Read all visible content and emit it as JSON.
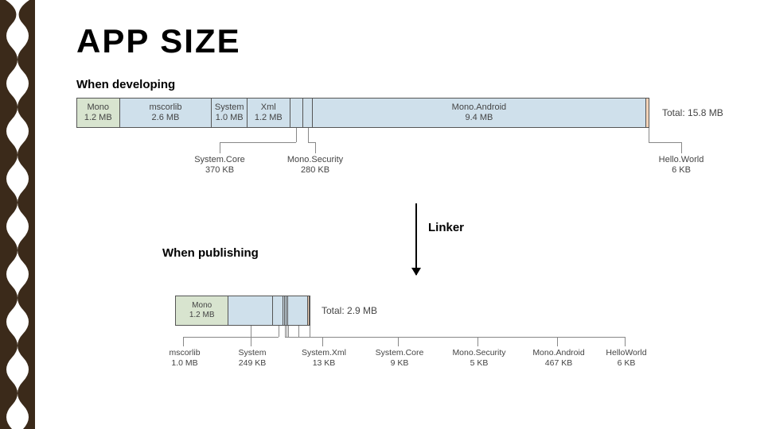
{
  "title": "APP SIZE",
  "labels": {
    "developing": "When developing",
    "publishing": "When publishing",
    "linker": "Linker"
  },
  "chart_data": [
    {
      "type": "bar",
      "title": "When developing",
      "total_label": "Total: 15.8 MB",
      "segments": [
        {
          "name": "Mono",
          "size_label": "1.2 MB",
          "kb": 1229,
          "color": "mono",
          "inline": true
        },
        {
          "name": "mscorlib",
          "size_label": "2.6 MB",
          "kb": 2662,
          "color": "lib",
          "inline": true
        },
        {
          "name": "System",
          "size_label": "1.0 MB",
          "kb": 1024,
          "color": "lib",
          "inline": true
        },
        {
          "name": "Xml",
          "size_label": "1.2 MB",
          "kb": 1229,
          "color": "lib",
          "inline": true
        },
        {
          "name": "System.Core",
          "size_label": "370 KB",
          "kb": 370,
          "color": "lib",
          "inline": false
        },
        {
          "name": "Mono.Security",
          "size_label": "280 KB",
          "kb": 280,
          "color": "lib",
          "inline": false
        },
        {
          "name": "Mono.Android",
          "size_label": "9.4 MB",
          "kb": 9626,
          "color": "lib",
          "inline": true
        },
        {
          "name": "Hello.World",
          "size_label": "6 KB",
          "kb": 6,
          "color": "orange",
          "inline": false
        }
      ]
    },
    {
      "type": "bar",
      "title": "When publishing",
      "total_label": "Total: 2.9 MB",
      "segments": [
        {
          "name": "Mono",
          "size_label": "1.2 MB",
          "kb": 1229,
          "color": "mono",
          "inline": true
        },
        {
          "name": "mscorlib",
          "size_label": "1.0 MB",
          "kb": 1024,
          "color": "lib",
          "inline": false
        },
        {
          "name": "System",
          "size_label": "249 KB",
          "kb": 249,
          "color": "lib",
          "inline": false
        },
        {
          "name": "System.Xml",
          "size_label": "13 KB",
          "kb": 13,
          "color": "lib",
          "inline": false
        },
        {
          "name": "System.Core",
          "size_label": "9 KB",
          "kb": 9,
          "color": "lib",
          "inline": false
        },
        {
          "name": "Mono.Security",
          "size_label": "5 KB",
          "kb": 5,
          "color": "lib",
          "inline": false
        },
        {
          "name": "Mono.Android",
          "size_label": "467 KB",
          "kb": 467,
          "color": "lib",
          "inline": false
        },
        {
          "name": "HelloWorld",
          "size_label": "6 KB",
          "kb": 6,
          "color": "orange",
          "inline": false
        }
      ]
    }
  ]
}
